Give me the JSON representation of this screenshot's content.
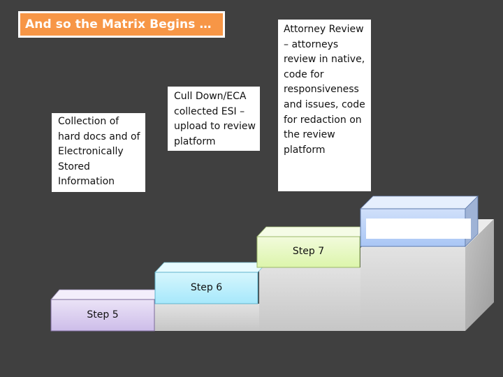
{
  "title": "And so the Matrix Begins …",
  "colors": {
    "background": "#404040",
    "title_fill": "#f79646",
    "step5": "#d9ccf0",
    "step6": "#b3ecfb",
    "step7": "#e4f7bd",
    "step8": "#b9cff7"
  },
  "steps": [
    {
      "label": "Step 5",
      "description": "Collection of hard docs and of Electronically Stored Information"
    },
    {
      "label": "Step 6",
      "description": "Cull Down/ECA collected ESI – upload to review platform"
    },
    {
      "label": "Step 7",
      "description": "Attorney Review – attorneys review in native, code for responsiveness and issues, code for redaction on the review platform"
    },
    {
      "label": "",
      "description": ""
    }
  ]
}
